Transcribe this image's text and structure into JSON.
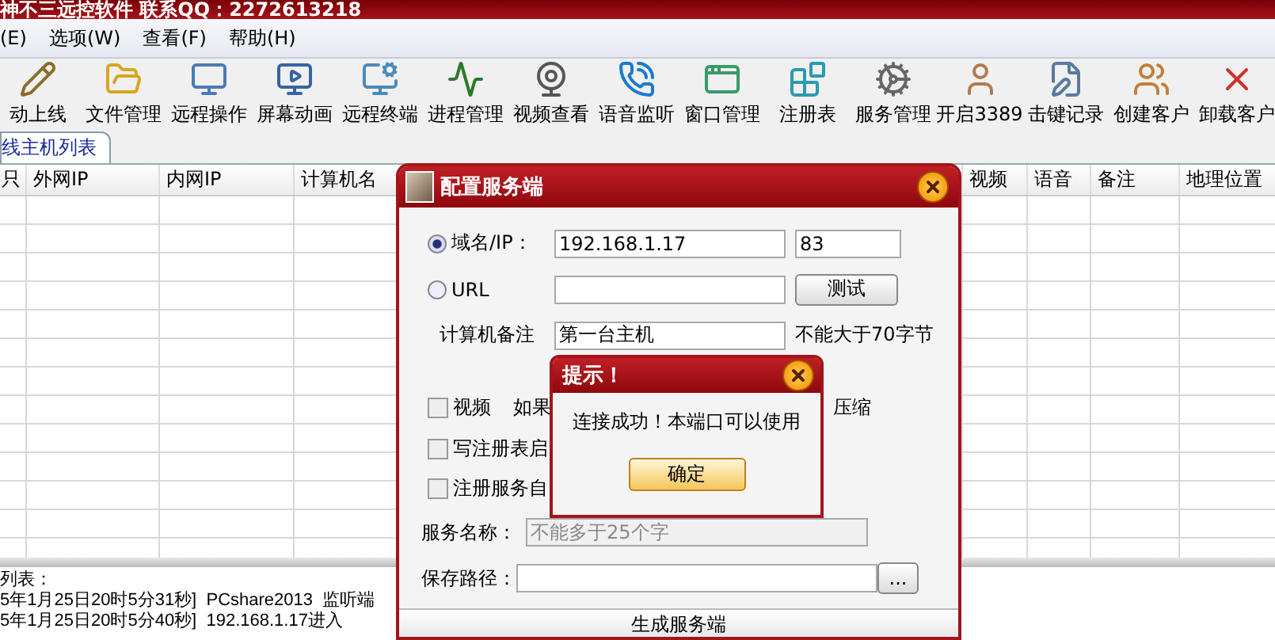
{
  "window": {
    "title": "神不三远控软件 联系QQ：2272613218"
  },
  "menu": [
    "(E)",
    "选项(W)",
    "查看(F)",
    "帮助(H)"
  ],
  "toolbar": [
    "动上线",
    "文件管理",
    "远程操作",
    "屏幕动画",
    "远程终端",
    "进程管理",
    "视频查看",
    "语音监听",
    "窗口管理",
    "注册表",
    "服务管理",
    "开启3389",
    "击键记录",
    "创建客户",
    "卸载客户"
  ],
  "tabs": [
    {
      "label": "线主机列表",
      "selected": true
    }
  ],
  "table": {
    "columns": [
      "只",
      "外网IP",
      "内网IP",
      "计算机名",
      "视频",
      "语音",
      "备注",
      "地理位置"
    ]
  },
  "log": {
    "title": "列表：",
    "lines": [
      "5年1月25日20时5分31秒]  PCshare2013  监听端",
      "5年1月25日20时5分40秒]  192.168.1.17进入"
    ]
  },
  "config_dialog": {
    "title": "配置服务端",
    "address_modes": [
      {
        "label": "域名/IP：",
        "selected": true,
        "value": "192.168.1.17"
      },
      {
        "label": "URL",
        "selected": false
      }
    ],
    "port": "83",
    "test_button": "测试",
    "remark": {
      "label": "计算机备注",
      "value": "第一台主机",
      "hint": "不能大于70字节"
    },
    "options": [
      {
        "label": "视频",
        "checked": false
      },
      {
        "label": "写注册表启",
        "checked": false
      },
      {
        "label": "注册服务自",
        "checked": false
      }
    ],
    "option_note": "如果",
    "compress_label": "压缩",
    "service_name": {
      "label": "服务名称：",
      "placeholder": "不能多于25个字",
      "disabled": true
    },
    "save_path": {
      "label": "保存路径：",
      "browse_button": "..."
    },
    "generate_button": "生成服务端"
  },
  "alert": {
    "title": "提示！",
    "message": "连接成功！本端口可以使用",
    "ok_button": "确定"
  }
}
